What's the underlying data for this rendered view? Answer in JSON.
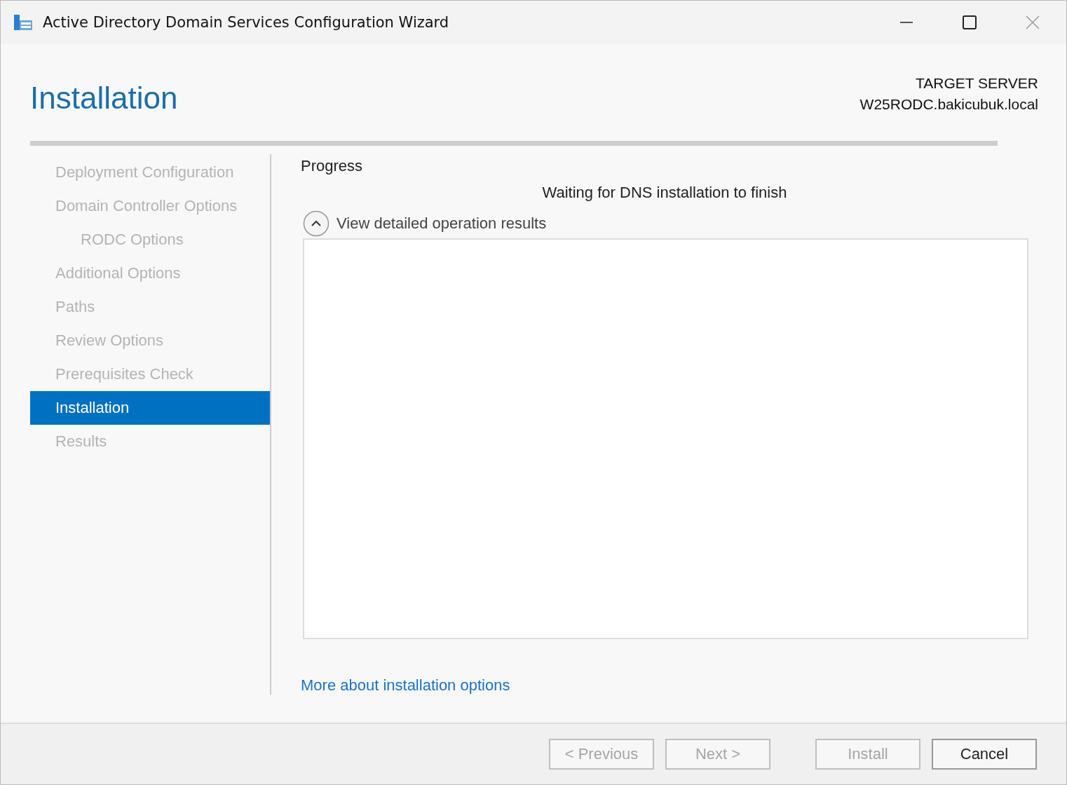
{
  "window": {
    "title": "Active Directory Domain Services Configuration Wizard"
  },
  "header": {
    "title": "Installation",
    "target_label": "TARGET SERVER",
    "target_server": "W25RODC.bakicubuk.local"
  },
  "sidebar": {
    "items": [
      {
        "label": "Deployment Configuration",
        "selected": false
      },
      {
        "label": "Domain Controller Options",
        "selected": false,
        "children": [
          {
            "label": "RODC Options",
            "selected": false
          }
        ]
      },
      {
        "label": "Additional Options",
        "selected": false
      },
      {
        "label": "Paths",
        "selected": false
      },
      {
        "label": "Review Options",
        "selected": false
      },
      {
        "label": "Prerequisites Check",
        "selected": false
      },
      {
        "label": "Installation",
        "selected": true
      },
      {
        "label": "Results",
        "selected": false
      }
    ]
  },
  "content": {
    "section_title": "Progress",
    "status": "Waiting for DNS installation to finish",
    "details_toggle": {
      "label": "View detailed operation results",
      "expanded": true
    },
    "link": "More about installation options"
  },
  "buttons": [
    {
      "label": "< Previous",
      "disabled": true
    },
    {
      "label": "Next >",
      "disabled": true
    },
    {
      "label": "Install",
      "disabled": true
    },
    {
      "label": "Cancel",
      "disabled": false
    }
  ]
}
